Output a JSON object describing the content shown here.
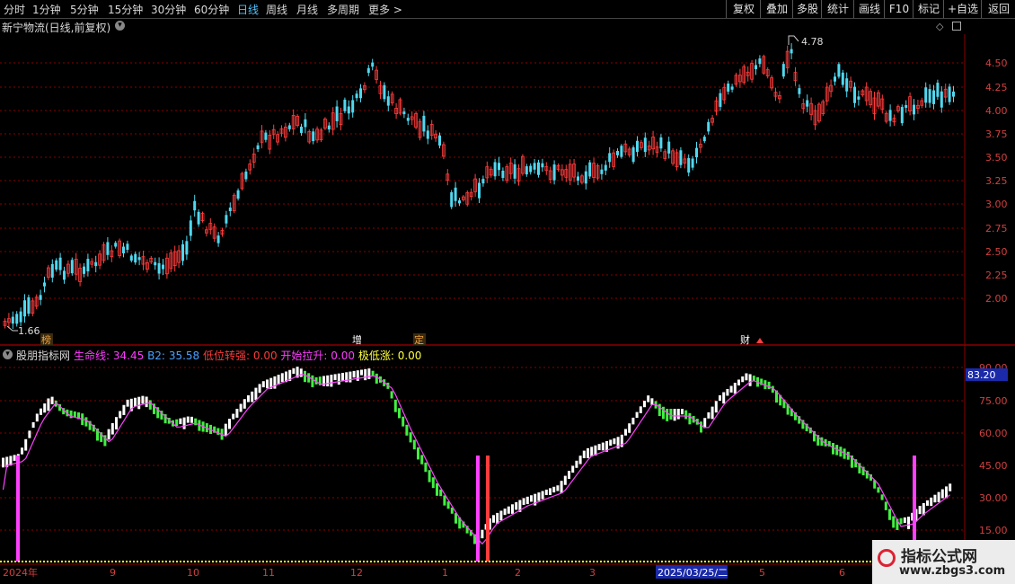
{
  "toolbar": {
    "periods": [
      "分时",
      "1分钟",
      "5分钟",
      "15分钟",
      "30分钟",
      "60分钟",
      "日线",
      "周线",
      "月线",
      "多周期",
      "更多 >"
    ],
    "active_period": "日线",
    "right_buttons": [
      "复权",
      "叠加",
      "多股",
      "统计",
      "画线",
      "F10",
      "标记",
      "+自选",
      "返回"
    ]
  },
  "main_chart": {
    "title": "新宁物流(日线,前复权)",
    "price_axis": [
      "4.50",
      "4.25",
      "4.00",
      "3.75",
      "3.50",
      "3.25",
      "3.00",
      "2.75",
      "2.50",
      "2.25",
      "2.00"
    ],
    "high_label": "4.78",
    "low_label": "1.66",
    "markers": [
      {
        "text": "榜",
        "color": "#e8a040"
      },
      {
        "text": "增",
        "color": "#ffffff"
      },
      {
        "text": "定",
        "color": "#e8a040"
      },
      {
        "text": "财",
        "color": "#ffffff"
      }
    ]
  },
  "indicator": {
    "name": "股朋指标网",
    "items": [
      {
        "label": "生命线:",
        "value": "34.45",
        "color": "#ff3cff"
      },
      {
        "label": "B2:",
        "value": "35.58",
        "color": "#4aa0ff"
      },
      {
        "label": "低位转强:",
        "value": "0.00",
        "color": "#ff3a3a"
      },
      {
        "label": "开始拉升:",
        "value": "0.00",
        "color": "#ff3cff"
      },
      {
        "label": "极低涨:",
        "value": "0.00",
        "color": "#ffff40"
      }
    ],
    "axis": [
      "90.00",
      "75.00",
      "60.00",
      "45.00",
      "30.00",
      "15.00"
    ],
    "current_value": "83.20"
  },
  "time_axis": {
    "labels": [
      "2024年",
      "9",
      "10",
      "11",
      "12",
      "1",
      "2",
      "3",
      "2025/03/25/二",
      "5",
      "6"
    ]
  },
  "watermark": {
    "line1": "指标公式网",
    "line2": "www.zbgs3.com"
  },
  "colors": {
    "up": "#ff3c3c",
    "down": "#50d8f0",
    "green_bar": "#40f040",
    "white_bar": "#ffffff",
    "lifeline": "#ff40ff",
    "grid": "#8a0000"
  }
}
